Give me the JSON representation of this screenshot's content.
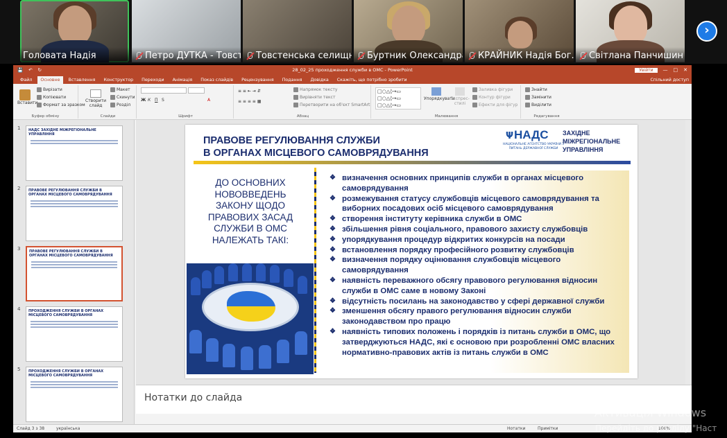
{
  "participants": [
    {
      "name": "Головата Надія",
      "muted": false
    },
    {
      "name": "Петро ДУТКА - Товст...",
      "muted": true
    },
    {
      "name": "Товстенська селищн...",
      "muted": true
    },
    {
      "name": "Буртник Олександра ...",
      "muted": true
    },
    {
      "name": "КРАЙНИК Надія Бог...",
      "muted": true
    },
    {
      "name": "Світлана Панчишин ...",
      "muted": true
    }
  ],
  "powerpoint": {
    "window_title": "28_02_25 проходження служби в ОМС - PowerPoint",
    "signin_button": "Увійти",
    "tabs": [
      "Файл",
      "Основне",
      "Вставлення",
      "Конструктор",
      "Переходи",
      "Анімація",
      "Показ слайдів",
      "Рецензування",
      "Подання",
      "Довідка"
    ],
    "tell_me": "Скажіть, що потрібно зробити",
    "share": "Спільний доступ",
    "ribbon": {
      "paste": "Вставити",
      "cut": "Вирізати",
      "copy": "Копіювати",
      "format_painter": "Формат за зразком",
      "clipboard": "Буфер обміну",
      "new_slide": "Створити слайд",
      "layout": "Макет",
      "reset": "Скинути",
      "section": "Розділ",
      "slides": "Слайди",
      "font": "Шрифт",
      "text_direction": "Напрямок тексту",
      "align_text": "Вирівняти текст",
      "smartart": "Перетворити на об'єкт SmartArt",
      "paragraph": "Абзац",
      "arrange": "Упорядкувати",
      "quick_styles": "Експрес-стилі",
      "shape_fill": "Заливка фігури",
      "shape_outline": "Контур фігури",
      "shape_effects": "Ефекти для фігур",
      "drawing": "Малювання",
      "find": "Знайти",
      "replace": "Замінити",
      "select": "Виділити",
      "editing": "Редагування"
    },
    "thumbnails": [
      {
        "num": "1",
        "title": "НАДС ЗАХІДНЕ МІЖРЕГІОНАЛЬНЕ УПРАВЛІННЯ"
      },
      {
        "num": "2",
        "title": "ПРАВОВЕ РЕГУЛЮВАННЯ СЛУЖБИ В ОРГАНАХ МІСЦЕВОГО САМОВРЯДУВАННЯ"
      },
      {
        "num": "3",
        "title": "ПРАВОВЕ РЕГУЛЮВАННЯ СЛУЖБИ В ОРГАНАХ МІСЦЕВОГО САМОВРЯДУВАННЯ"
      },
      {
        "num": "4",
        "title": "ПРОХОДЖЕННЯ СЛУЖБИ В ОРГАНАХ МІСЦЕВОГО САМОВРЯДУВАННЯ"
      },
      {
        "num": "5",
        "title": "ПРОХОДЖЕННЯ СЛУЖБИ В ОРГАНАХ МІСЦЕВОГО САМОВРЯДУВАННЯ"
      }
    ],
    "slide": {
      "title_line1": "ПРАВОВЕ РЕГУЛЮВАННЯ СЛУЖБИ",
      "title_line2": "В ОРГАНАХ МІСЦЕВОГО САМОВРЯДУВАННЯ",
      "logo_abbr": "НАДС",
      "logo_sub": "НАЦІОНАЛЬНЕ АГЕНТСТВО УКРАЇНИ З ПИТАНЬ ДЕРЖАВНОЇ СЛУЖБИ",
      "logo_dept_1": "ЗАХІДНЕ",
      "logo_dept_2": "МІЖРЕГІОНАЛЬНЕ",
      "logo_dept_3": "УПРАВЛІННЯ",
      "left_heading": "ДО ОСНОВНИХ НОВОВВЕДЕНЬ ЗАКОНУ ЩОДО ПРАВОВИХ ЗАСАД СЛУЖБИ В ОМС НАЛЕЖАТЬ ТАКІ:",
      "bullets": [
        "визначення основних принципів служби в органах місцевого самоврядування",
        "розмежування статусу службовців місцевого самоврядування та виборних посадових осіб місцевого самоврядування",
        "створення інституту керівника служби в ОМС",
        "збільшення рівня соціального, правового захисту службовців",
        "упорядкування процедур відкритих конкурсів на посади",
        "встановлення порядку професійного розвитку службовців",
        "визначення порядку оцінювання службовців місцевого самоврядування",
        "наявність переважного обсягу правового регулювання відносин служби в ОМС саме в новому Законі",
        "відсутність посилань на законодавство у сфері державної служби",
        "зменшення обсягу правого регулювання відносин служби законодавством про працю",
        "наявність типових положень і порядків із питань служби в ОМС, що затверджуються НАДС, які є основою при розробленні ОМС власних нормативно-правових актів із питань служби в ОМС"
      ]
    },
    "notes_placeholder": "Нотатки до слайда",
    "status": {
      "slide_counter": "Слайд 3 з 38",
      "language": "українська",
      "notes": "Нотатки",
      "comments": "Примітки",
      "zoom": "100%"
    }
  },
  "watermark": {
    "line1": "Активація Windows",
    "line2": "Перейдіть до розділу \"Наст"
  }
}
